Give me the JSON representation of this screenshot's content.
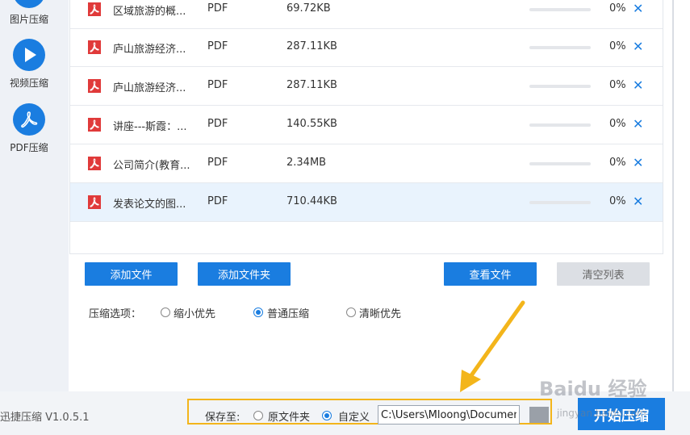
{
  "sidebar": {
    "items": [
      {
        "label": "图片压缩"
      },
      {
        "label": "视频压缩"
      },
      {
        "label": "PDF压缩"
      }
    ]
  },
  "files": [
    {
      "name": "区域旅游的概...",
      "type": "PDF",
      "size": "69.72KB",
      "percent": "0%",
      "progress": 0
    },
    {
      "name": "庐山旅游经济...",
      "type": "PDF",
      "size": "287.11KB",
      "percent": "0%",
      "progress": 0
    },
    {
      "name": "庐山旅游经济...",
      "type": "PDF",
      "size": "287.11KB",
      "percent": "0%",
      "progress": 0
    },
    {
      "name": "讲座---斯霞：...",
      "type": "PDF",
      "size": "140.55KB",
      "percent": "0%",
      "progress": 0
    },
    {
      "name": "公司简介(教育...",
      "type": "PDF",
      "size": "2.34MB",
      "percent": "0%",
      "progress": 0
    },
    {
      "name": "发表论文的图...",
      "type": "PDF",
      "size": "710.44KB",
      "percent": "0%",
      "progress": 0
    }
  ],
  "close_glyph": "✕",
  "buttons": {
    "add_file": "添加文件",
    "add_folder": "添加文件夹",
    "view_files": "查看文件",
    "clear_list": "清空列表"
  },
  "options": {
    "label": "压缩选项：",
    "choices": [
      {
        "label": "缩小优先",
        "checked": false
      },
      {
        "label": "普通压缩",
        "checked": true
      },
      {
        "label": "清晰优先",
        "checked": false
      }
    ]
  },
  "footer": {
    "version": "迅捷压缩 V1.0.5.1",
    "save_to": "保存至:",
    "save_options": [
      {
        "label": "原文件夹",
        "checked": false
      },
      {
        "label": "自定义",
        "checked": true
      }
    ],
    "path_value": "C:\\Users\\Mloong\\Documents",
    "start_button": "开始压缩"
  },
  "watermark": {
    "logo": "Baidu 经验",
    "sub": "jingyan.baidu.com"
  },
  "colors": {
    "accent": "#1a7de0",
    "highlight_box": "#f3b51b",
    "arrow": "#f3b51b"
  }
}
